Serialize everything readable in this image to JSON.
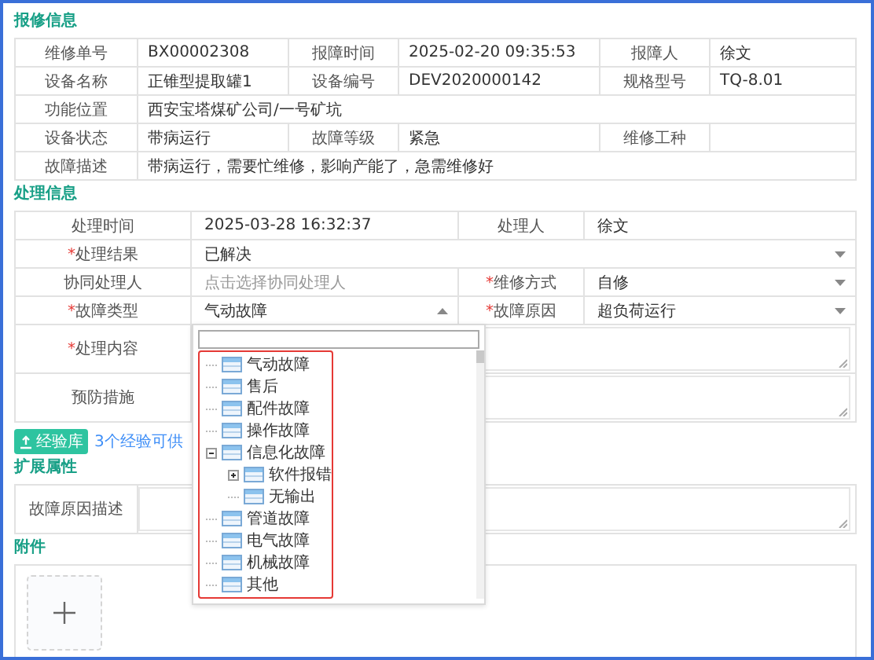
{
  "repair_info": {
    "title": "报修信息",
    "rows": [
      [
        {
          "label": "维修单号",
          "value": "BX00002308"
        },
        {
          "label": "报障时间",
          "value": "2025-02-20 09:35:53"
        },
        {
          "label": "报障人",
          "value": "徐文"
        }
      ],
      [
        {
          "label": "设备名称",
          "value": "正锥型提取罐1"
        },
        {
          "label": "设备编号",
          "value": "DEV2020000142"
        },
        {
          "label": "规格型号",
          "value": "TQ-8.01"
        }
      ],
      [
        {
          "label": "功能位置",
          "value": "西安宝塔煤矿公司/一号矿坑"
        }
      ],
      [
        {
          "label": "设备状态",
          "value": "带病运行"
        },
        {
          "label": "故障等级",
          "value": "紧急"
        },
        {
          "label": "维修工种"
        }
      ],
      [
        {
          "label": "故障描述",
          "value": "带病运行，需要忙维修，影响产能了，急需维修好"
        }
      ]
    ]
  },
  "handling_info": {
    "title": "处理信息",
    "rows": [
      [
        {
          "label": "处理时间",
          "kind": "text",
          "value": "2025-03-28 16:32:37"
        },
        {
          "label": "处理人",
          "kind": "text",
          "value": "徐文"
        }
      ],
      [
        {
          "label": "处理结果",
          "mark": "*",
          "kind": "select",
          "value": "已解决",
          "open": false
        }
      ],
      [
        {
          "label": "协同处理人",
          "kind": "picker",
          "placeholder": "点击选择协同处理人"
        },
        {
          "label": "维修方式",
          "mark": "*",
          "kind": "select",
          "value": "自修",
          "open": false
        }
      ],
      [
        {
          "label": "故障类型",
          "mark": "*",
          "kind": "select",
          "value": "气动故障",
          "open": true
        },
        {
          "label": "故障原因",
          "mark": "*",
          "kind": "select",
          "value": "超负荷运行",
          "open": false
        }
      ],
      [
        {
          "label": "处理内容",
          "mark": "*",
          "kind": "textarea"
        }
      ],
      [
        {
          "label": "预防措施",
          "kind": "textarea"
        }
      ]
    ]
  },
  "experience": {
    "button": "经验库",
    "link": "3个经验可供"
  },
  "fault_type_tree": [
    {
      "label": "气动故障",
      "kind": "leaf"
    },
    {
      "label": "售后",
      "kind": "leaf"
    },
    {
      "label": "配件故障",
      "kind": "leaf"
    },
    {
      "label": "操作故障",
      "kind": "leaf"
    },
    {
      "label": "信息化故障",
      "kind": "branch",
      "expanded": true,
      "children": [
        {
          "label": "软件报错",
          "kind": "branch",
          "expanded": false
        },
        {
          "label": "无输出",
          "kind": "leaf"
        }
      ]
    },
    {
      "label": "管道故障",
      "kind": "leaf"
    },
    {
      "label": "电气故障",
      "kind": "leaf"
    },
    {
      "label": "机械故障",
      "kind": "leaf"
    },
    {
      "label": "其他",
      "kind": "leaf"
    }
  ],
  "extended": {
    "title": "扩展属性",
    "rows": [
      [
        {
          "label": "故障原因描述",
          "kind": "textarea"
        }
      ]
    ]
  },
  "attachments": {
    "title": "附件"
  }
}
